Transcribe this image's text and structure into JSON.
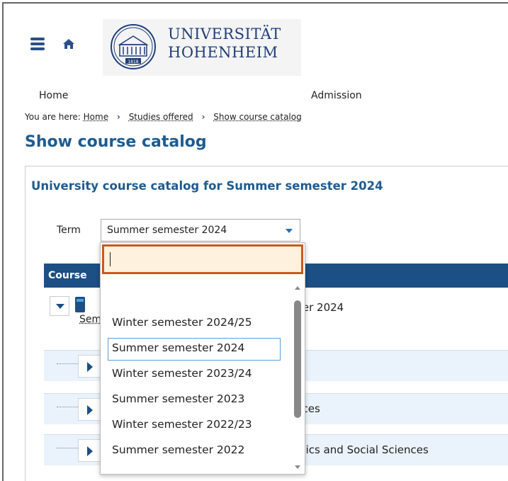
{
  "header": {
    "logo_line1": "UNIVERSITÄT",
    "logo_line2": "HOHENHEIM",
    "seal_year": "1818"
  },
  "nav": {
    "items": [
      {
        "label": "Home"
      },
      {
        "label": "Admission"
      }
    ]
  },
  "breadcrumb": {
    "prefix": "You are here:",
    "items": [
      "Home",
      "Studies offered",
      "Show course catalog"
    ]
  },
  "page": {
    "title": "Show course catalog"
  },
  "panel": {
    "title": "University course catalog for Summer semester 2024",
    "term_label": "Term",
    "term_value": "Summer semester 2024",
    "course_header": "Course",
    "root_text": "ter 2024",
    "root_link": "Sem",
    "rows": [
      {
        "label": ""
      },
      {
        "label": "nces"
      },
      {
        "label": "mics and Social Sciences"
      }
    ]
  },
  "dropdown": {
    "search_value": "",
    "options": [
      "Winter semester 2024/25",
      "Summer semester 2024",
      "Winter semester 2023/24",
      "Summer semester 2023",
      "Winter semester 2022/23",
      "Summer semester 2022"
    ],
    "selected": "Summer semester 2024"
  }
}
